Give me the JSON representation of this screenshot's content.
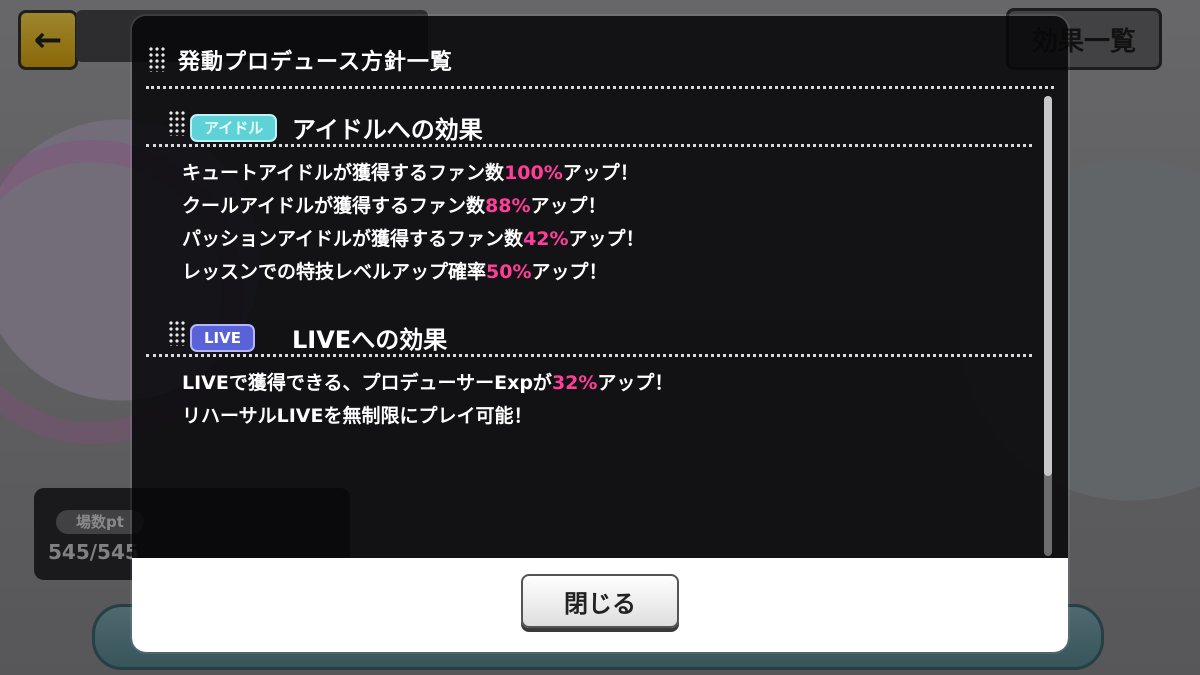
{
  "background": {
    "back_icon": "arrow-left-icon",
    "effect_list_button": "効果一覧",
    "venue_label": "場数pt",
    "venue_value": "545/545"
  },
  "modal": {
    "title": "発動プロデュース方針一覧",
    "sections": [
      {
        "tag": "アイドル",
        "title": "アイドルへの効果",
        "lines": [
          {
            "pre": "キュートアイドルが獲得するファン数",
            "value": "100%",
            "post": "アップ！"
          },
          {
            "pre": "クールアイドルが獲得するファン数",
            "value": "88%",
            "post": "アップ！"
          },
          {
            "pre": "パッションアイドルが獲得するファン数",
            "value": "42%",
            "post": "アップ！"
          },
          {
            "pre": "レッスンでの特技レベルアップ確率",
            "value": "50%",
            "post": "アップ！"
          }
        ]
      },
      {
        "tag": "LIVE",
        "title": "LIVEへの効果",
        "lines": [
          {
            "pre": "LIVEで獲得できる、プロデューサーExpが",
            "value": "32%",
            "post": "アップ！"
          },
          {
            "pre": "リハーサルLIVEを無制限にプレイ可能！",
            "value": "",
            "post": ""
          }
        ]
      }
    ],
    "close_label": "閉じる"
  },
  "colors": {
    "highlight": "#ff3e9a",
    "idol_tag": "#5fd2d7",
    "live_tag": "#5a62d8"
  }
}
